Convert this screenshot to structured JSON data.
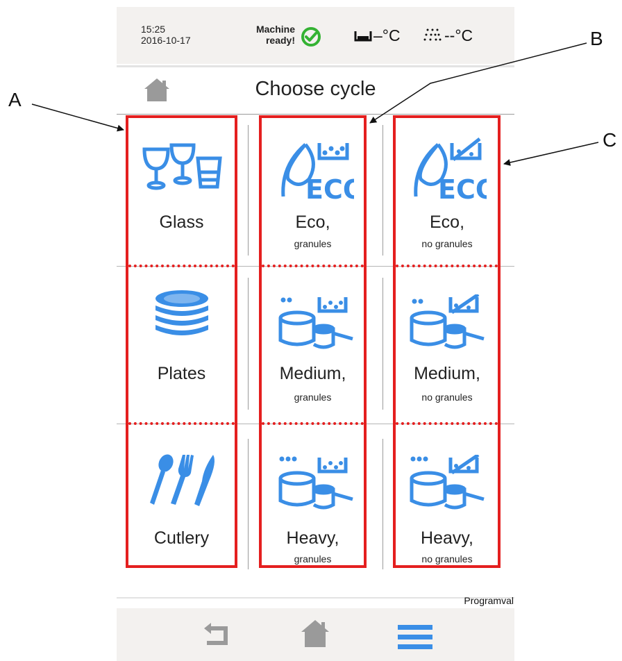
{
  "status": {
    "time": "15:25",
    "date": "2016-10-17",
    "machine_line1": "Machine",
    "machine_line2": "ready!",
    "tank_temp": "–°C",
    "rinse_temp": "--°C"
  },
  "title": "Choose cycle",
  "cycles": [
    {
      "label": "Glass",
      "sub": "",
      "icon": "glasses-icon"
    },
    {
      "label": "Eco,",
      "sub": "granules",
      "icon": "eco-granules-icon"
    },
    {
      "label": "Eco,",
      "sub": "no granules",
      "icon": "eco-no-granules-icon"
    },
    {
      "label": "Plates",
      "sub": "",
      "icon": "plates-icon"
    },
    {
      "label": "Medium,",
      "sub": "granules",
      "icon": "pots-medium-granules-icon"
    },
    {
      "label": "Medium,",
      "sub": "no granules",
      "icon": "pots-medium-no-granules-icon"
    },
    {
      "label": "Cutlery",
      "sub": "",
      "icon": "cutlery-icon"
    },
    {
      "label": "Heavy,",
      "sub": "granules",
      "icon": "pots-heavy-granules-icon"
    },
    {
      "label": "Heavy,",
      "sub": "no granules",
      "icon": "pots-heavy-no-granules-icon"
    }
  ],
  "callouts": {
    "a": "A",
    "b": "B",
    "c": "C"
  },
  "screen_name": "Programval",
  "colors": {
    "accent": "#3a8ee6",
    "annotation": "#e41f1f",
    "ok": "#34b233"
  }
}
